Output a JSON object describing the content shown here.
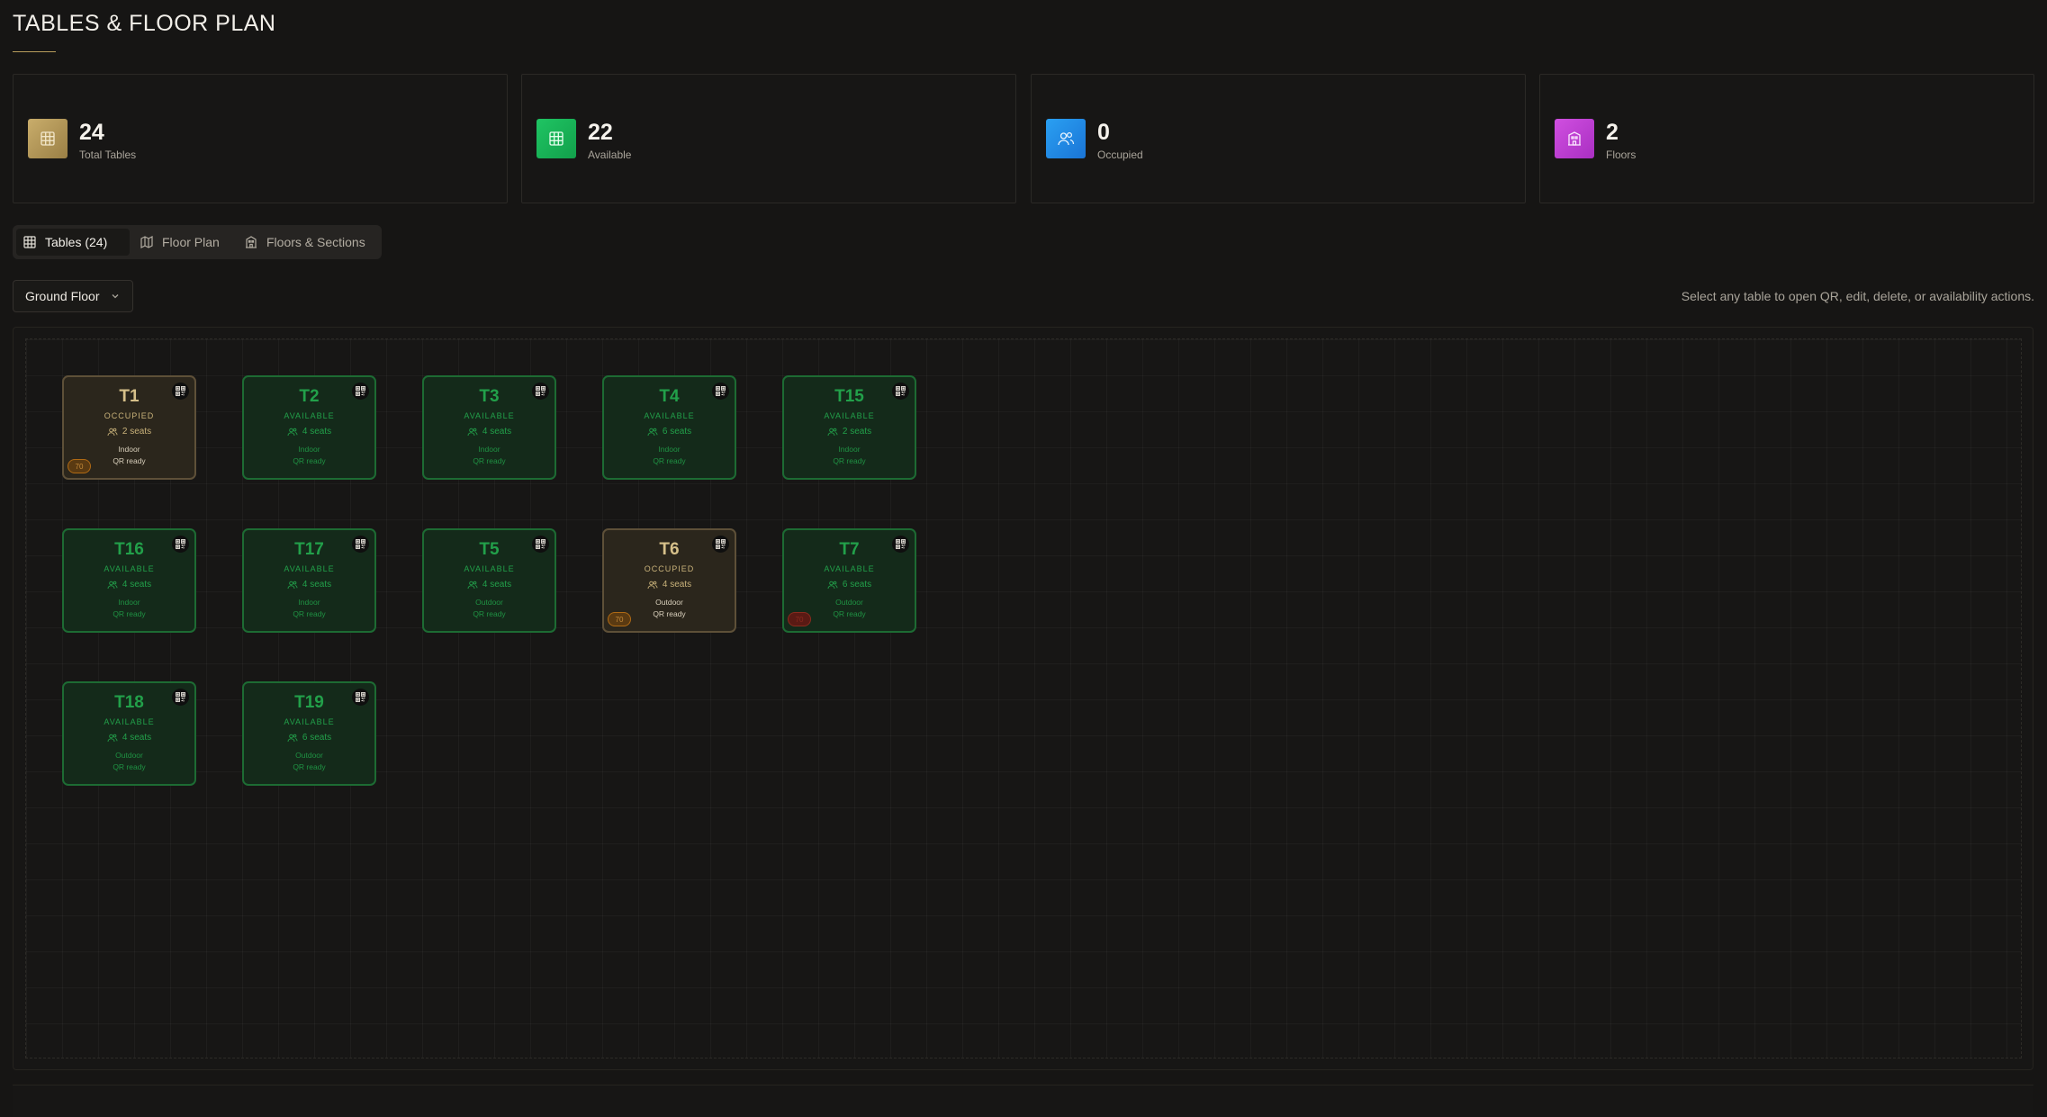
{
  "header": {
    "title": "TABLES & FLOOR PLAN"
  },
  "stats": [
    {
      "value": "24",
      "label": "Total Tables",
      "color": "#b89c5c",
      "icon": "grid-icon"
    },
    {
      "value": "22",
      "label": "Available",
      "color": "#19b35a",
      "icon": "grid-icon"
    },
    {
      "value": "0",
      "label": "Occupied",
      "color": "#1e8fe8",
      "icon": "users-icon"
    },
    {
      "value": "2",
      "label": "Floors",
      "color": "#c43ed6",
      "icon": "building-icon"
    }
  ],
  "tabs": [
    {
      "label": "Tables (24)",
      "icon": "grid-icon",
      "active": true
    },
    {
      "label": "Floor Plan",
      "icon": "map-icon",
      "active": false
    },
    {
      "label": "Floors & Sections",
      "icon": "building-icon",
      "active": false
    }
  ],
  "floor_select": {
    "value": "Ground Floor"
  },
  "hint": "Select any table to open QR, edit, delete, or availability actions.",
  "tables": [
    {
      "name": "T1",
      "status": "OCCUPIED",
      "seats": "2 seats",
      "zone": "Indoor",
      "qr": "QR ready",
      "state": "occupied",
      "badge": "70",
      "badge_color": "amber"
    },
    {
      "name": "T2",
      "status": "AVAILABLE",
      "seats": "4 seats",
      "zone": "Indoor",
      "qr": "QR ready",
      "state": "available"
    },
    {
      "name": "T3",
      "status": "AVAILABLE",
      "seats": "4 seats",
      "zone": "Indoor",
      "qr": "QR ready",
      "state": "available"
    },
    {
      "name": "T4",
      "status": "AVAILABLE",
      "seats": "6 seats",
      "zone": "Indoor",
      "qr": "QR ready",
      "state": "available"
    },
    {
      "name": "T15",
      "status": "AVAILABLE",
      "seats": "2 seats",
      "zone": "Indoor",
      "qr": "QR ready",
      "state": "available"
    },
    {
      "name": "T16",
      "status": "AVAILABLE",
      "seats": "4 seats",
      "zone": "Indoor",
      "qr": "QR ready",
      "state": "available"
    },
    {
      "name": "T17",
      "status": "AVAILABLE",
      "seats": "4 seats",
      "zone": "Indoor",
      "qr": "QR ready",
      "state": "available"
    },
    {
      "name": "T5",
      "status": "AVAILABLE",
      "seats": "4 seats",
      "zone": "Outdoor",
      "qr": "QR ready",
      "state": "available"
    },
    {
      "name": "T6",
      "status": "OCCUPIED",
      "seats": "4 seats",
      "zone": "Outdoor",
      "qr": "QR ready",
      "state": "occupied",
      "badge": "70",
      "badge_color": "amber"
    },
    {
      "name": "T7",
      "status": "AVAILABLE",
      "seats": "6 seats",
      "zone": "Outdoor",
      "qr": "QR ready",
      "state": "available",
      "badge": "70",
      "badge_color": "red"
    },
    {
      "name": "T18",
      "status": "AVAILABLE",
      "seats": "4 seats",
      "zone": "Outdoor",
      "qr": "QR ready",
      "state": "available"
    },
    {
      "name": "T19",
      "status": "AVAILABLE",
      "seats": "6 seats",
      "zone": "Outdoor",
      "qr": "QR ready",
      "state": "available"
    }
  ]
}
